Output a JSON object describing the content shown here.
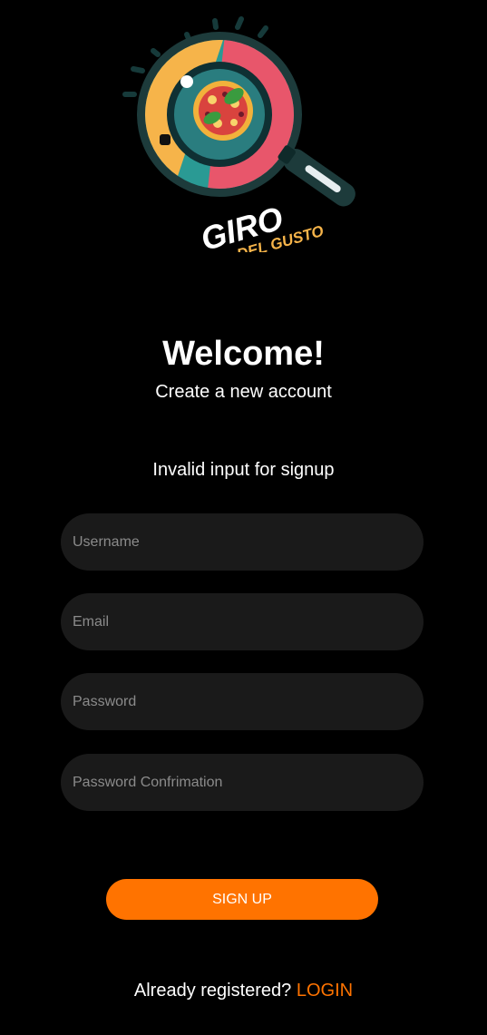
{
  "logo": {
    "text_main": "GIRO",
    "text_sub": "DEL GUSTO",
    "icon": "magnifying-glass-pizza-logo",
    "colors": {
      "brand_orange": "#ff7300",
      "logo_yellow": "#f6b44a",
      "logo_red": "#e8566b",
      "logo_teal": "#2a9a94"
    }
  },
  "header": {
    "title": "Welcome!",
    "subtitle": "Create a new account"
  },
  "error_message": "Invalid input for signup",
  "form": {
    "username_placeholder": "Username",
    "email_placeholder": "Email",
    "password_placeholder": "Password",
    "password_confirm_placeholder": "Password Confrimation",
    "submit_label": "SIGN UP"
  },
  "footer": {
    "prompt": "Already registered? ",
    "login_label": "LOGIN"
  }
}
